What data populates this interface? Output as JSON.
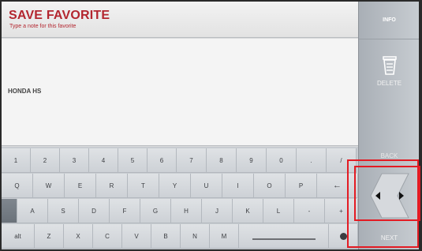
{
  "header": {
    "title": "SAVE FAVORITE",
    "subtitle": "Type a note for this favorite"
  },
  "note": {
    "value": "HONDA HS"
  },
  "side": {
    "info_label": "INFO",
    "delete_label": "DELETE",
    "back_label": "BACK",
    "next_label": "NEXT"
  },
  "keyboard": {
    "row1": [
      "1",
      "2",
      "3",
      "4",
      "5",
      "6",
      "7",
      "8",
      "9",
      "0",
      ".",
      "/"
    ],
    "row2": [
      "Q",
      "W",
      "E",
      "R",
      "T",
      "Y",
      "U",
      "I",
      "O",
      "P",
      "←"
    ],
    "row3": [
      "A",
      "S",
      "D",
      "F",
      "G",
      "H",
      "J",
      "K",
      "L",
      "-",
      "+"
    ],
    "row4": [
      "alt",
      "Z",
      "X",
      "C",
      "V",
      "B",
      "N",
      "M"
    ]
  },
  "colors": {
    "title": "#b3262f",
    "highlight": "#e31b23"
  },
  "icons": {
    "delete": "trash-icon",
    "nav": "left-right-arrows-icon"
  }
}
